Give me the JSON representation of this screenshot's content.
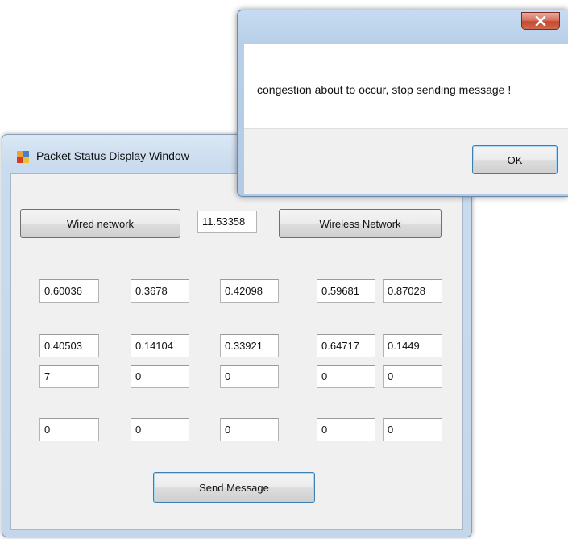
{
  "main_window": {
    "title": "Packet Status Display Window",
    "wired_button_label": "Wired network",
    "total_value": "11.53358",
    "wireless_button_label": "Wireless Network",
    "grid_rows": [
      [
        "0.60036",
        "0.3678",
        "0.42098",
        "0.59681",
        "0.87028"
      ],
      [
        "0.40503",
        "0.14104",
        "0.33921",
        "0.64717",
        "0.1449"
      ],
      [
        "7",
        "0",
        "0",
        "0",
        "0"
      ],
      [
        "0",
        "0",
        "0",
        "0",
        "0"
      ]
    ],
    "send_button_label": "Send Message"
  },
  "message_box": {
    "close_glyph": "x",
    "message": "congestion about to occur, stop sending message !",
    "ok_label": "OK"
  }
}
